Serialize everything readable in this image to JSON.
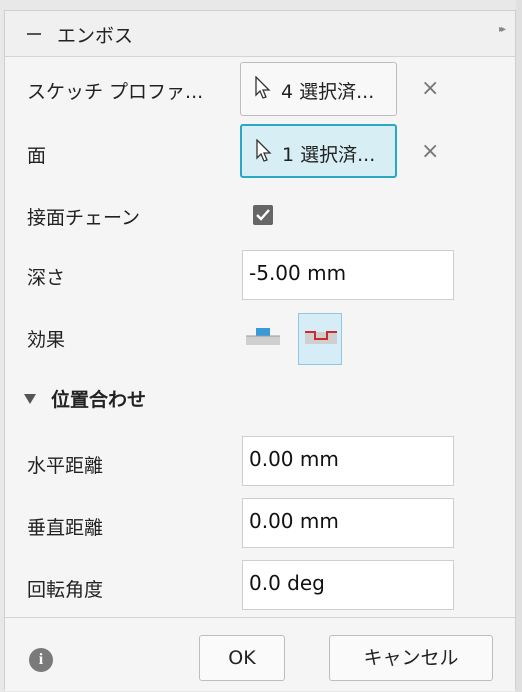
{
  "panel": {
    "title": "エンボス"
  },
  "rows": {
    "sketch_profile": {
      "label": "スケッチ プロファ...",
      "button": "4 選択済..."
    },
    "face": {
      "label": "面",
      "button": "1 選択済..."
    },
    "tangent_chain": {
      "label": "接面チェーン",
      "checked": true
    },
    "depth": {
      "label": "深さ",
      "value": "-5.00 mm"
    },
    "effect": {
      "label": "効果",
      "options": [
        "emboss-icon",
        "deboss-icon"
      ],
      "selected": "deboss-icon"
    }
  },
  "alignment": {
    "title": "位置合わせ",
    "horizontal": {
      "label": "水平距離",
      "value": "0.00 mm"
    },
    "vertical": {
      "label": "垂直距離",
      "value": "0.00 mm"
    },
    "rotation": {
      "label": "回転角度",
      "value": "0.0 deg"
    }
  },
  "footer": {
    "ok_label": "OK",
    "cancel_label": "キャンセル"
  },
  "colors": {
    "accent": "#2aa7c1",
    "active_bg": "#d7eef4",
    "deboss_red": "#cc2b2b"
  }
}
